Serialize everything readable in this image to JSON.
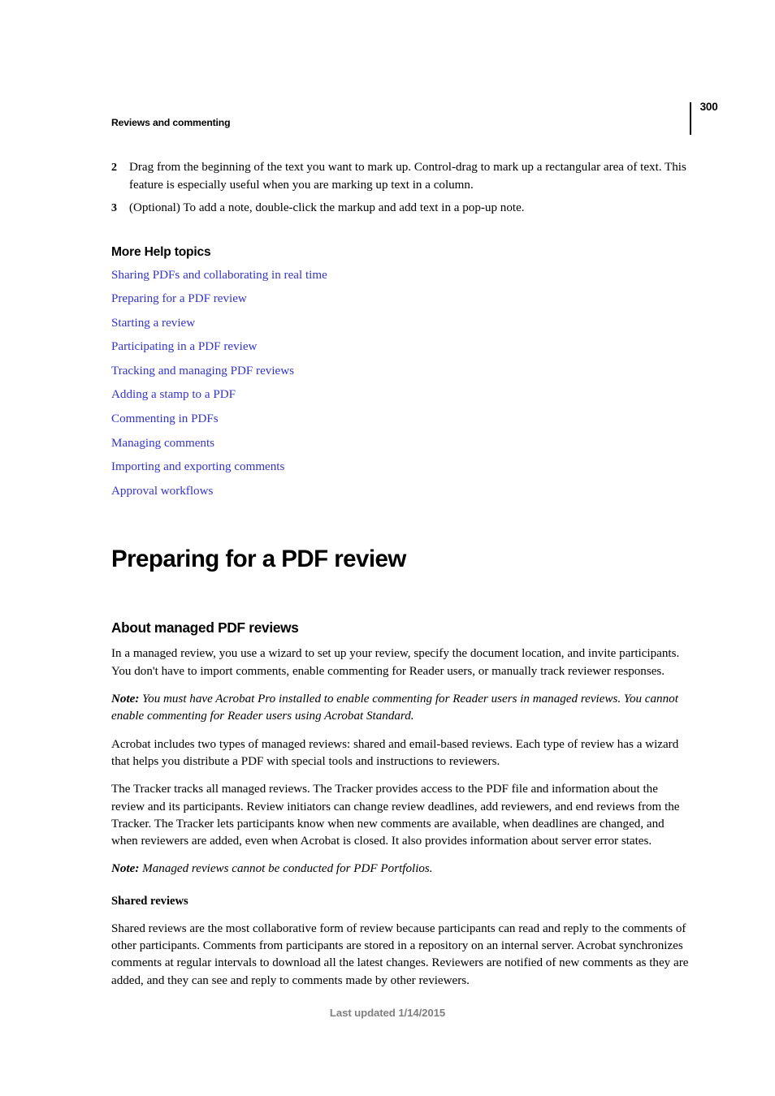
{
  "header": {
    "running_head": "Reviews and commenting",
    "page_number": "300"
  },
  "steps": [
    {
      "number": "2",
      "text": "Drag from the beginning of the text you want to mark up. Control-drag to mark up a rectangular area of text. This feature is especially useful when you are marking up text in a column."
    },
    {
      "number": "3",
      "text": "(Optional) To add a note, double-click the markup and add text in a pop-up note."
    }
  ],
  "more_help": {
    "heading": "More Help topics",
    "links": [
      "Sharing PDFs and collaborating in real time",
      "Preparing for a PDF review",
      "Starting a review",
      "Participating in a PDF review",
      "Tracking and managing PDF reviews",
      "Adding a stamp to a PDF",
      "Commenting in PDFs",
      "Managing comments",
      "Importing and exporting comments",
      "Approval workflows"
    ],
    "link_color": "#3333cc"
  },
  "chapter": {
    "title": "Preparing for a PDF review"
  },
  "topic": {
    "heading": "About managed PDF reviews",
    "para_1": "In a managed review, you use a wizard to set up your review, specify the document location, and invite participants. You don't have to import comments, enable commenting for Reader users, or manually track reviewer responses.",
    "note_1_label": "Note:",
    "note_1_text": " You must have Acrobat Pro installed to enable commenting for Reader users in managed reviews. You cannot enable commenting for Reader users using Acrobat Standard.",
    "para_2": "Acrobat includes two types of managed reviews: shared and email-based reviews. Each type of review has a wizard that helps you distribute a PDF with special tools and instructions to reviewers.",
    "para_3": "The Tracker tracks all managed reviews. The Tracker provides access to the PDF file and information about the review and its participants. Review initiators can change review deadlines, add reviewers, and end reviews from the Tracker. The Tracker lets participants know when new comments are available, when deadlines are changed, and when reviewers are added, even when Acrobat is closed. It also provides information about server error states.",
    "note_2_label": "Note:",
    "note_2_text": " Managed reviews cannot be conducted for PDF Portfolios.",
    "sub_heading": "Shared reviews",
    "para_4": "Shared reviews are the most collaborative form of review because participants can read and reply to the comments of other participants. Comments from participants are stored in a repository on an internal server. Acrobat synchronizes comments at regular intervals to download all the latest changes. Reviewers are notified of new comments as they are added, and they can see and reply to comments made by other reviewers."
  },
  "footer": {
    "text": "Last updated 1/14/2015"
  }
}
